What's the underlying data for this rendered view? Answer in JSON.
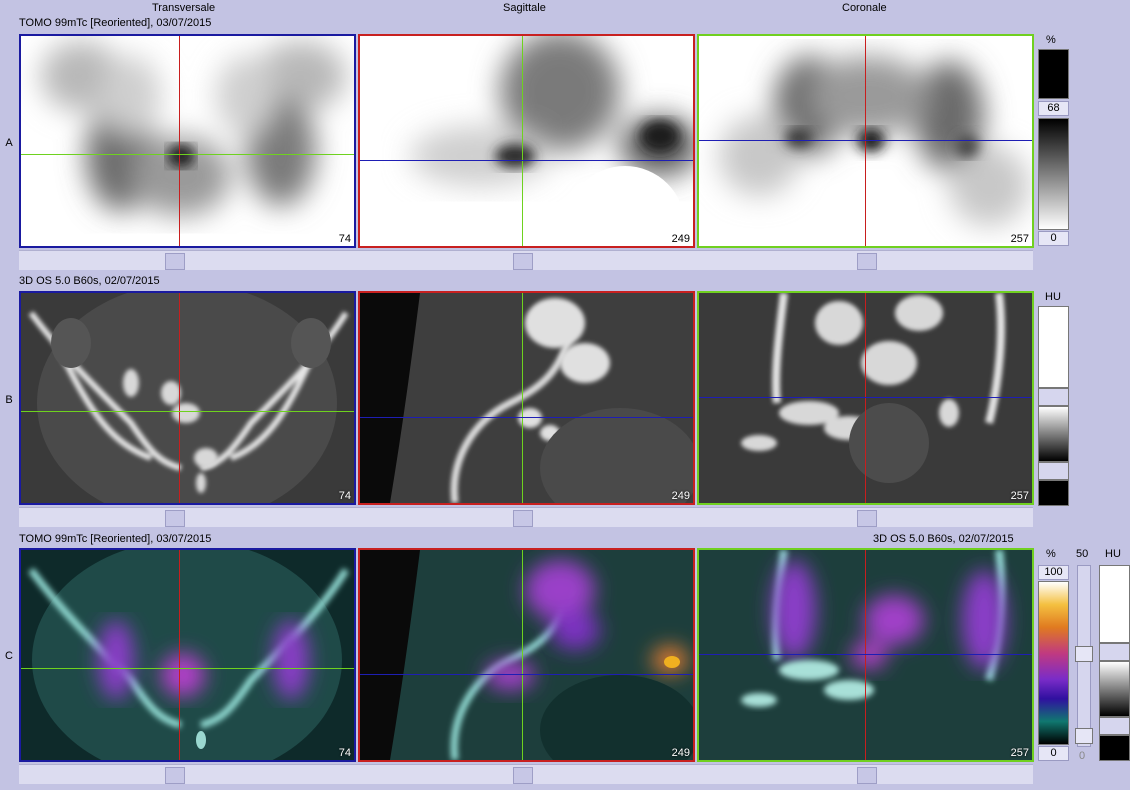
{
  "header": {
    "col_transversale": "Transversale",
    "col_sagittale": "Sagittale",
    "col_coronale": "Coronale"
  },
  "rows": {
    "a": {
      "label": "A",
      "series": "TOMO 99mTc [Reoriented], 03/07/2015"
    },
    "b": {
      "label": "B",
      "series": "3D  OS  5.0  B60s, 02/07/2015"
    },
    "c": {
      "label": "C",
      "series_left": "TOMO 99mTc [Reoriented], 03/07/2015",
      "series_right": "3D  OS  5.0  B60s, 02/07/2015"
    }
  },
  "slices": {
    "transversale": "74",
    "sagittale": "249",
    "coronale": "257"
  },
  "colorbars": {
    "a": {
      "unit": "%",
      "upper": "68",
      "lower": "0"
    },
    "b": {
      "unit": "HU"
    },
    "c": {
      "unit_pct": "%",
      "top": "100",
      "bottom": "0",
      "slider_top": "50",
      "slider_bottom": "0",
      "unit_hu": "HU"
    }
  },
  "colors": {
    "background": "#c3c3e3",
    "crosshair_vertical_red": "#c81e1e",
    "crosshair_vertical_green": "#6ed21e",
    "crosshair_horizontal_green": "#6ed21e",
    "crosshair_horizontal_blue": "#1e1eb4",
    "border_transversale": "#1a1aa0",
    "border_sagittale": "#c82020",
    "border_coronale": "#70d020"
  }
}
